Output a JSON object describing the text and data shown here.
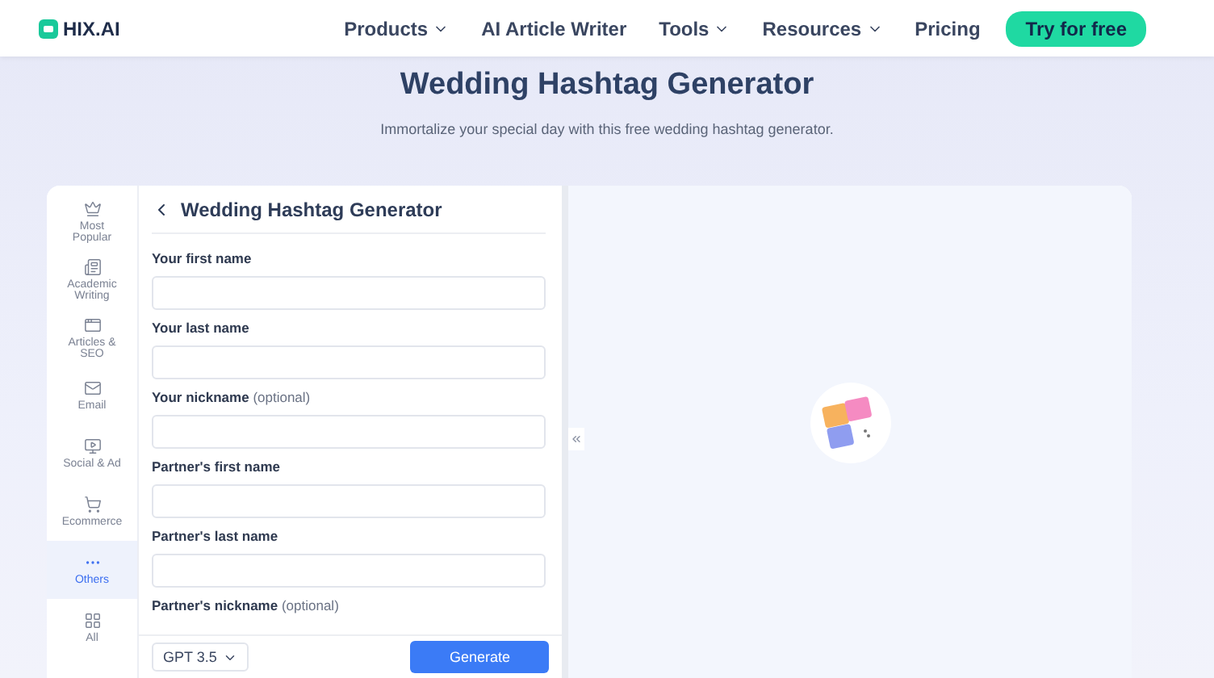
{
  "header": {
    "logo": "HIX.AI",
    "nav": [
      {
        "label": "Products",
        "dropdown": true
      },
      {
        "label": "AI Article Writer",
        "dropdown": false
      },
      {
        "label": "Tools",
        "dropdown": true
      },
      {
        "label": "Resources",
        "dropdown": true
      },
      {
        "label": "Pricing",
        "dropdown": false
      }
    ],
    "cta": "Try for free"
  },
  "hero": {
    "title": "Wedding Hashtag Generator",
    "subtitle": "Immortalize your special day with this free wedding hashtag generator."
  },
  "sidebar": [
    {
      "kind": "crown",
      "label": "Most Popular",
      "selected": false
    },
    {
      "kind": "academic",
      "label": "Academic Writing",
      "selected": false
    },
    {
      "kind": "articles",
      "label": "Articles & SEO",
      "selected": false
    },
    {
      "kind": "email",
      "label": "Email",
      "selected": false
    },
    {
      "kind": "social",
      "label": "Social & Ad",
      "selected": false
    },
    {
      "kind": "ecommerce",
      "label": "Ecommerce",
      "selected": false
    },
    {
      "kind": "others",
      "label": "Others",
      "selected": true
    },
    {
      "kind": "all",
      "label": "All",
      "selected": false
    }
  ],
  "form": {
    "title": "Wedding Hashtag Generator",
    "fields": [
      {
        "label": "Your first name"
      },
      {
        "label": "Your last name"
      },
      {
        "label": "Your nickname",
        "note": "(optional)"
      },
      {
        "label": "Partner's first name"
      },
      {
        "label": "Partner's last name"
      },
      {
        "label": "Partner's nickname",
        "note": "(optional)"
      }
    ],
    "model": "GPT 3.5",
    "submit": "Generate"
  }
}
